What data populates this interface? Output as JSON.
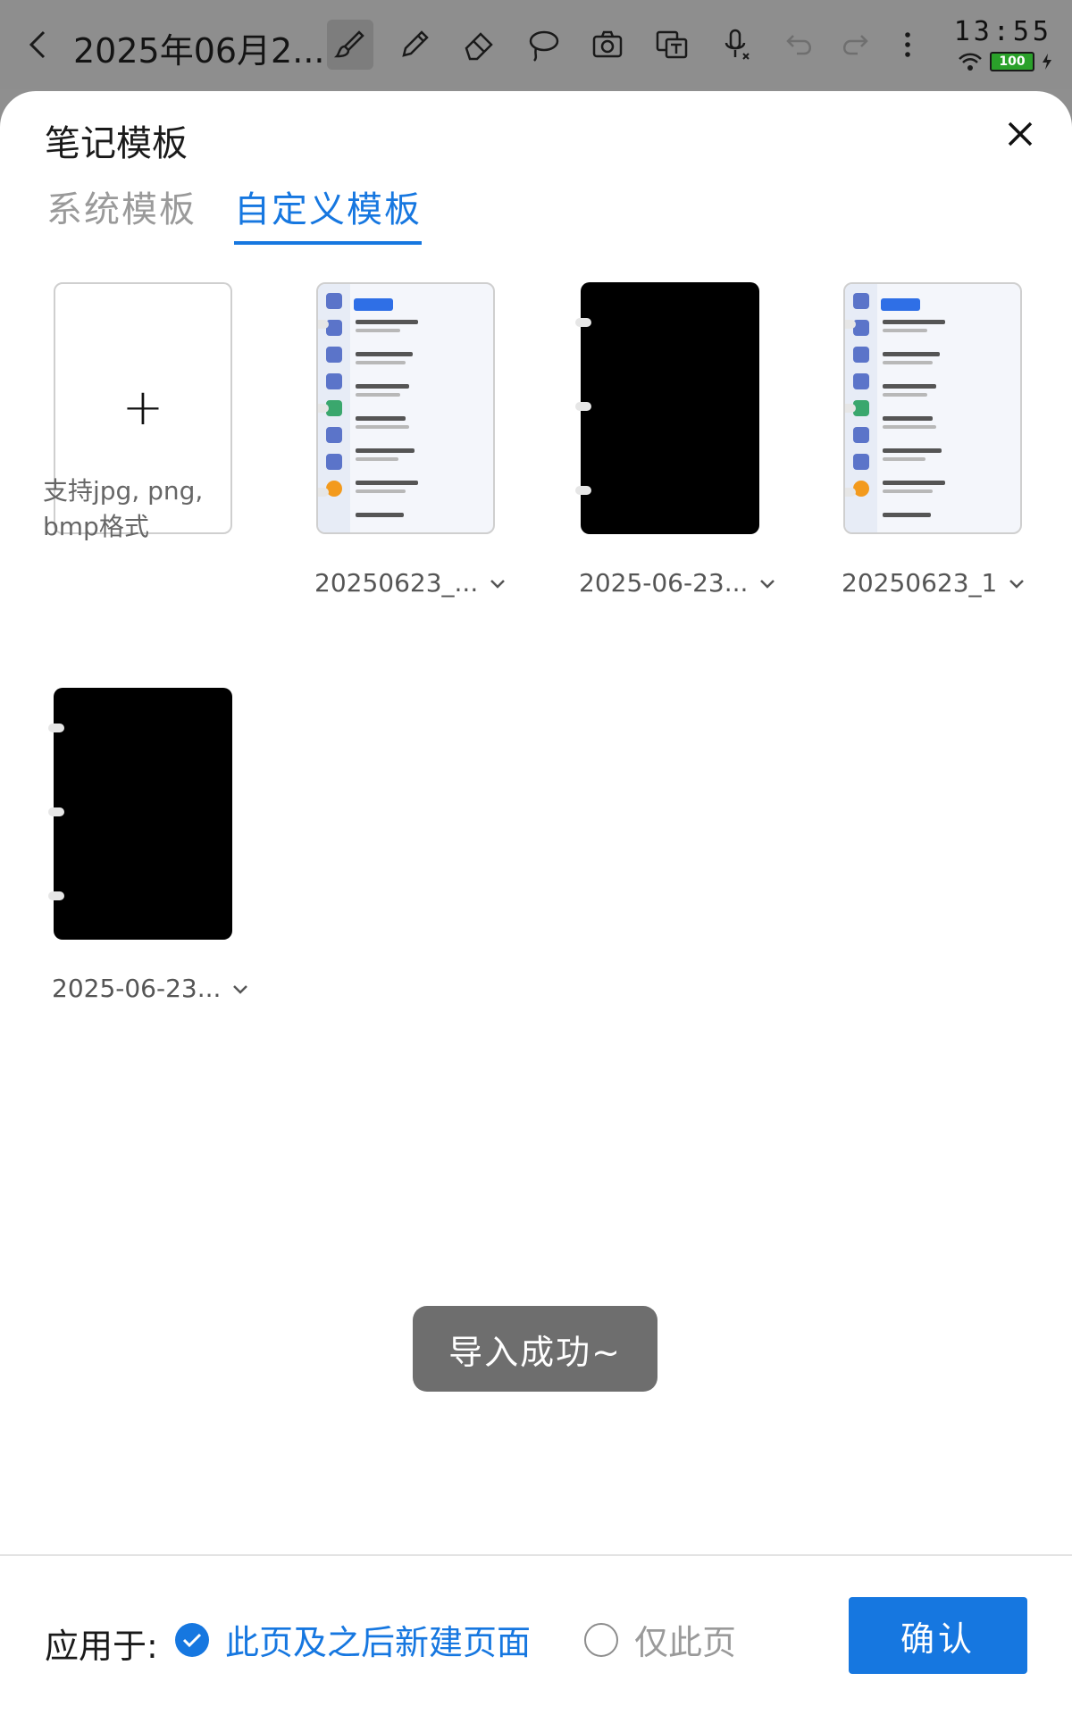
{
  "topbar": {
    "doc_title": "2025年06月2...",
    "tools": [
      "brush-icon",
      "pencil-icon",
      "eraser-icon",
      "lasso-icon",
      "camera-icon",
      "translate-icon",
      "mic-icon",
      "undo-icon",
      "redo-icon",
      "more-icon"
    ],
    "active_tool": "brush-icon"
  },
  "status": {
    "time": "13:55",
    "battery": "100"
  },
  "sheet": {
    "title": "笔记模板",
    "tabs": [
      {
        "label": "系统模板",
        "active": false
      },
      {
        "label": "自定义模板",
        "active": true
      }
    ]
  },
  "templates": {
    "add_hint": "支持jpg, png, bmp格式",
    "items": [
      {
        "name": "20250623_...",
        "style": "screenshot"
      },
      {
        "name": "2025-06-23...",
        "style": "black"
      },
      {
        "name": "20250623_1",
        "style": "screenshot"
      },
      {
        "name": "2025-06-23...",
        "style": "black"
      }
    ]
  },
  "toast": "导入成功~",
  "footer": {
    "apply_label": "应用于:",
    "option_all": "此页及之后新建页面",
    "option_this": "仅此页",
    "selected": "option_all",
    "confirm": "确认"
  },
  "colors": {
    "accent": "#1677e0",
    "toast_bg": "#6e6e6e",
    "dim_bg": "#8e8e8e"
  }
}
